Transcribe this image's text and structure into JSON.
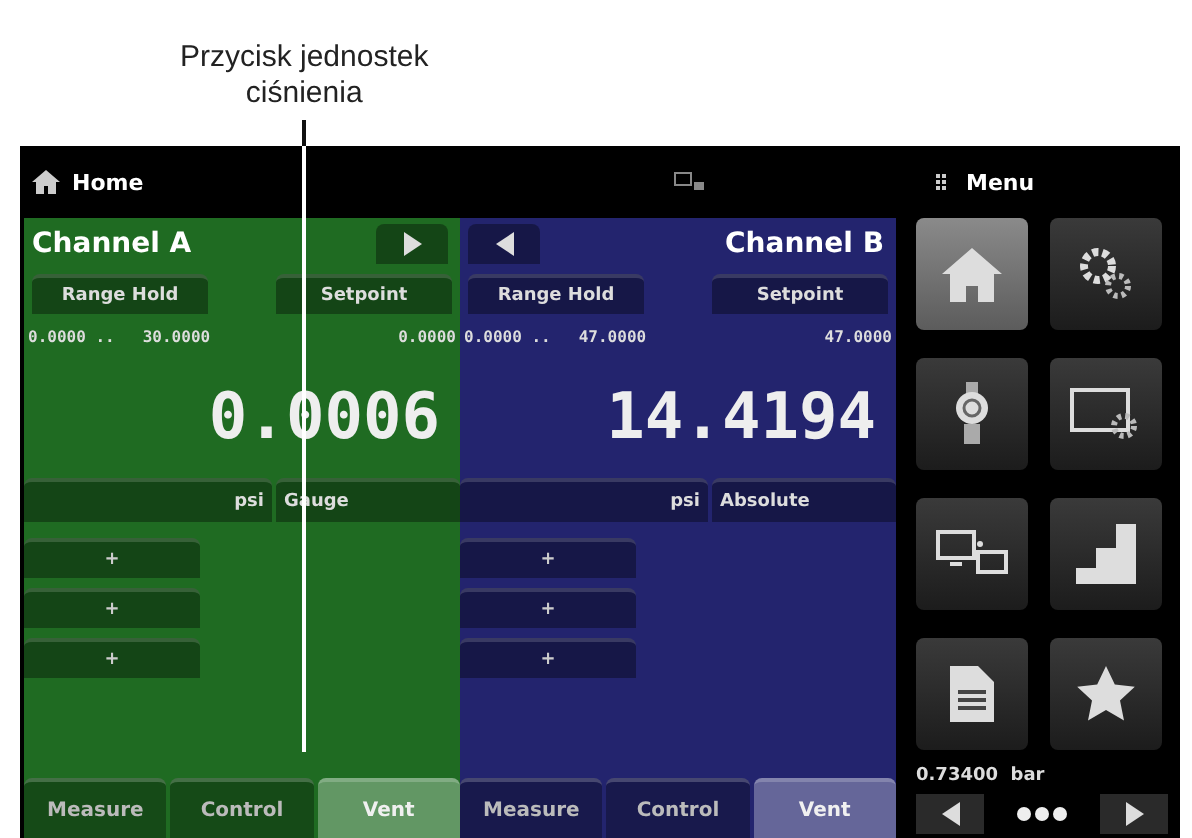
{
  "caption": "Przycisk jednostek\nciśnienia",
  "header": {
    "title": "Home",
    "menu_title": "Menu"
  },
  "channels": [
    {
      "name": "Channel A",
      "kind": "left",
      "color": "#1f6b22",
      "buttons": [
        "Range Hold",
        "Setpoint"
      ],
      "range_low": "0.0000 ..",
      "range_high": "30.0000",
      "setpoint": "0.0000",
      "reading": "0.0006",
      "unit": "psi",
      "mode": "Gauge",
      "plus": [
        "+",
        "+",
        "+"
      ],
      "tabs": [
        {
          "label": "Measure",
          "selected": false
        },
        {
          "label": "Control",
          "selected": false
        },
        {
          "label": "Vent",
          "selected": true
        }
      ]
    },
    {
      "name": "Channel B",
      "kind": "right",
      "color": "#23246e",
      "buttons": [
        "Range Hold",
        "Setpoint"
      ],
      "range_low": "0.0000 ..",
      "range_high": "47.0000",
      "setpoint": "47.0000",
      "reading": "14.4194",
      "unit": "psi",
      "mode": "Absolute",
      "plus": [
        "+",
        "+",
        "+"
      ],
      "tabs": [
        {
          "label": "Measure",
          "selected": false
        },
        {
          "label": "Control",
          "selected": false
        },
        {
          "label": "Vent",
          "selected": true
        }
      ]
    }
  ],
  "menu": {
    "tiles": [
      {
        "kind": "home",
        "selected": true
      },
      {
        "kind": "gears",
        "selected": false
      },
      {
        "kind": "regulator",
        "selected": false
      },
      {
        "kind": "display",
        "selected": false
      },
      {
        "kind": "network",
        "selected": false
      },
      {
        "kind": "steps",
        "selected": false
      },
      {
        "kind": "document",
        "selected": false
      },
      {
        "kind": "star",
        "selected": false
      }
    ],
    "barometer": "0.73400  bar"
  }
}
